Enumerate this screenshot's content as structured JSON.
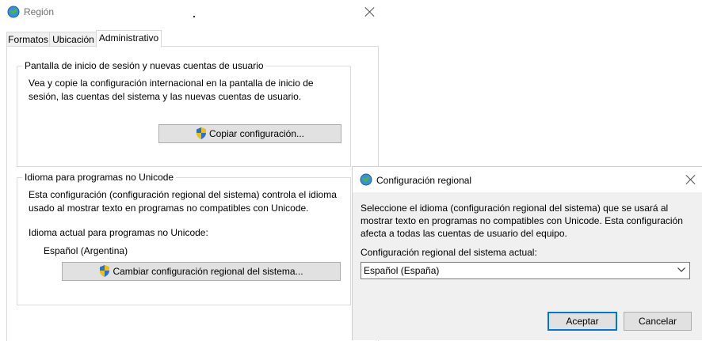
{
  "main": {
    "title": "Región",
    "tabs": [
      {
        "label": "Formatos"
      },
      {
        "label": "Ubicación"
      },
      {
        "label": "Administrativo"
      }
    ],
    "group1": {
      "legend": "Pantalla de inicio de sesión y nuevas cuentas de usuario",
      "line1": "Vea y copie la configuración internacional en la pantalla de inicio de",
      "line2": "sesión, las cuentas del sistema y las nuevas cuentas de usuario.",
      "button": "Copiar configuración..."
    },
    "group2": {
      "legend": "Idioma para programas no Unicode",
      "line1": "Esta configuración (configuración regional del sistema) controla el idioma",
      "line2": "usado al mostrar texto en programas no compatibles con Unicode.",
      "current_label": "Idioma actual para programas no Unicode:",
      "current_value": "Español (Argentina)",
      "button": "Cambiar configuración regional del sistema..."
    }
  },
  "dialog": {
    "title": "Configuración regional",
    "line1": "Seleccione el idioma (configuración regional del sistema) que se usará al",
    "line2": "mostrar texto en programas no compatibles con Unicode. Esta configuración",
    "line3": "afecta a todas las cuentas de usuario del equipo.",
    "current_label": "Configuración regional del sistema actual:",
    "selected": "Español (España)",
    "accept": "Aceptar",
    "cancel": "Cancelar"
  },
  "colors": {
    "accent": "#0078d7",
    "button_bg": "#e1e1e1",
    "dialog_bg": "#f0f0f0"
  },
  "icons": [
    "globe-icon",
    "close-icon",
    "shield-icon",
    "chevron-down-icon"
  ]
}
